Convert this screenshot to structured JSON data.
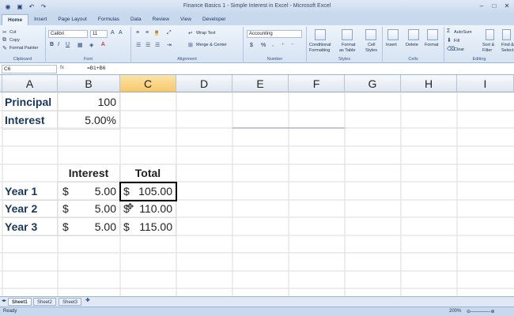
{
  "window": {
    "title": "Finance Basics 1 - Simple Interest in Excel - Microsoft Excel"
  },
  "ribbon_tabs": [
    "Home",
    "Insert",
    "Page Layout",
    "Formulas",
    "Data",
    "Review",
    "View",
    "Developer"
  ],
  "ribbon": {
    "clipboard": {
      "cut": "Cut",
      "copy": "Copy",
      "format_painter": "Format Painter",
      "label": "Clipboard"
    },
    "font": {
      "family": "Calibri",
      "size": "11",
      "label": "Font"
    },
    "alignment": {
      "wrap": "Wrap Text",
      "merge": "Merge & Center",
      "label": "Alignment"
    },
    "number": {
      "format": "Accounting",
      "currency": "$",
      "percent": "%",
      "label": "Number"
    },
    "styles": {
      "conditional": "Conditional",
      "conditional2": "Formatting",
      "format_table": "Format",
      "format_table2": "as Table",
      "cell_styles": "Cell",
      "cell_styles2": "Styles",
      "label": "Styles"
    },
    "cells": {
      "insert": "Insert",
      "delete": "Delete",
      "format": "Format",
      "label": "Cells"
    },
    "editing": {
      "autosum": "AutoSum",
      "fill": "Fill",
      "clear": "Clear",
      "sort": "Sort &",
      "sort2": "Filter",
      "find": "Find &",
      "find2": "Select",
      "label": "Editing"
    }
  },
  "formula_bar": {
    "name_box": "C6",
    "fx": "fx",
    "formula": "=B1+B6"
  },
  "columns": [
    "A",
    "B",
    "C",
    "D",
    "E",
    "F",
    "G",
    "H",
    "I"
  ],
  "cells": {
    "a1": "Principal",
    "b1": "100",
    "a2": "Interest",
    "b2": "5.00%",
    "b5": "Interest",
    "c5": "Total",
    "a6": "Year 1",
    "b6_sym": "$",
    "b6_val": "5.00",
    "c6_sym": "$",
    "c6_val": "105.00",
    "a7": "Year 2",
    "b7_sym": "$",
    "b7_val": "5.00",
    "c7_sym": "$",
    "c7_val": "110.00",
    "a8": "Year 3",
    "b8_sym": "$",
    "b8_val": "5.00",
    "c8_sym": "$",
    "c8_val": "115.00"
  },
  "sheets": [
    "Sheet1",
    "Sheet2",
    "Sheet3"
  ],
  "status": {
    "mode": "Ready",
    "zoom": "200%"
  },
  "colors": {
    "header_blue": "#17375e",
    "selected_header": "#f6c96a"
  }
}
